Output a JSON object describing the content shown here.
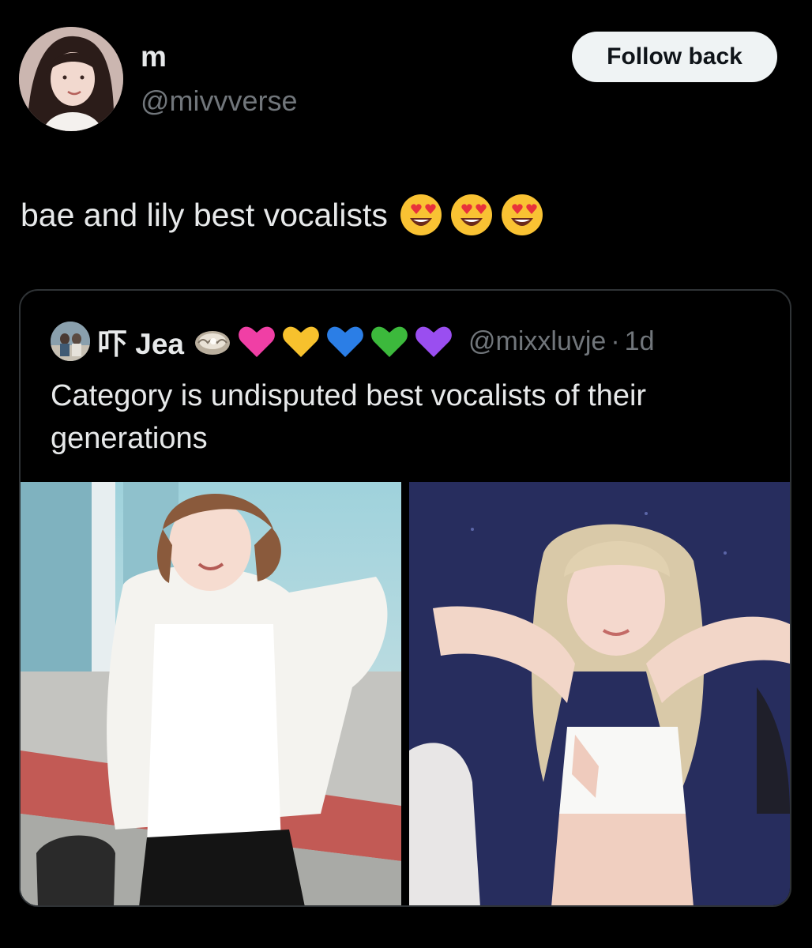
{
  "tweet": {
    "author": {
      "display_name": "m",
      "handle": "@mivvverse",
      "avatar_icon": "profile-photo"
    },
    "follow_button_label": "Follow back",
    "text": "bae and lily best vocalists",
    "emojis": [
      "smiling-face-with-heart-eyes",
      "smiling-face-with-heart-eyes",
      "smiling-face-with-heart-eyes"
    ]
  },
  "quoted_tweet": {
    "author": {
      "display_name": "吓 Jea",
      "handle": "@mixxluvje",
      "avatar_icon": "profile-photo",
      "name_badges": [
        "oyster-emoji",
        "pink-heart",
        "yellow-heart",
        "blue-heart",
        "green-heart",
        "purple-heart"
      ]
    },
    "separator": "·",
    "timestamp": "1d",
    "text": "Category is undisputed best vocalists of their generations",
    "media": [
      {
        "icon": "photo-woman-white-cardigan"
      },
      {
        "icon": "photo-woman-blonde-stage"
      }
    ]
  },
  "colors": {
    "background": "#000000",
    "primary_text": "#e7e9ea",
    "secondary_text": "#71767b",
    "border": "#2f3336",
    "button_bg": "#eff3f4",
    "button_text": "#0f1419"
  }
}
